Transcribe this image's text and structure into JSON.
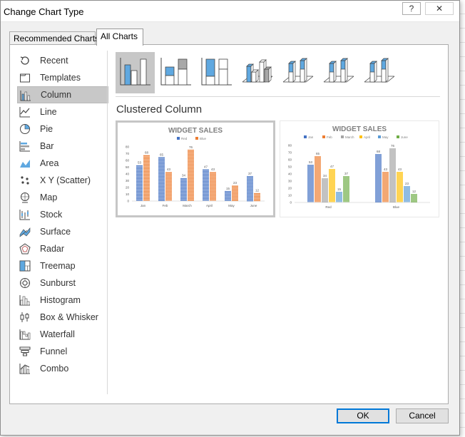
{
  "window": {
    "title": "Change Chart Type",
    "help_label": "?",
    "close_label": "✕"
  },
  "tabs": [
    {
      "label": "Recommended Charts"
    },
    {
      "label": "All Charts"
    }
  ],
  "chart_types": [
    {
      "label": "Recent",
      "icon": "recent-icon"
    },
    {
      "label": "Templates",
      "icon": "templates-icon"
    },
    {
      "label": "Column",
      "icon": "column-icon",
      "selected": true
    },
    {
      "label": "Line",
      "icon": "line-icon"
    },
    {
      "label": "Pie",
      "icon": "pie-icon"
    },
    {
      "label": "Bar",
      "icon": "bar-icon"
    },
    {
      "label": "Area",
      "icon": "area-icon"
    },
    {
      "label": "X Y (Scatter)",
      "icon": "scatter-icon"
    },
    {
      "label": "Map",
      "icon": "map-icon"
    },
    {
      "label": "Stock",
      "icon": "stock-icon"
    },
    {
      "label": "Surface",
      "icon": "surface-icon"
    },
    {
      "label": "Radar",
      "icon": "radar-icon"
    },
    {
      "label": "Treemap",
      "icon": "treemap-icon"
    },
    {
      "label": "Sunburst",
      "icon": "sunburst-icon"
    },
    {
      "label": "Histogram",
      "icon": "histogram-icon"
    },
    {
      "label": "Box & Whisker",
      "icon": "box-whisker-icon"
    },
    {
      "label": "Waterfall",
      "icon": "waterfall-icon"
    },
    {
      "label": "Funnel",
      "icon": "funnel-icon"
    },
    {
      "label": "Combo",
      "icon": "combo-icon"
    }
  ],
  "subtypes": [
    {
      "name": "clustered-column",
      "selected": true
    },
    {
      "name": "stacked-column"
    },
    {
      "name": "100-stacked-column"
    },
    {
      "name": "3d-clustered-column"
    },
    {
      "name": "3d-stacked-column"
    },
    {
      "name": "3d-100-stacked-column"
    },
    {
      "name": "3d-column"
    }
  ],
  "selected_subtype_title": "Clustered Column",
  "colors": {
    "red_series": "#4472c4",
    "blue_series": "#ed7d31",
    "march": "#a5a5a5",
    "april": "#ffc000",
    "may": "#5b9bd5",
    "june": "#70ad47",
    "icon_blue": "#5fa8e0"
  },
  "chart_data": [
    {
      "type": "bar",
      "title": "WIDGET SALES",
      "categories": [
        "Jan",
        "Feb",
        "March",
        "April",
        "May",
        "June"
      ],
      "series": [
        {
          "name": "Red",
          "values": [
            53,
            65,
            34,
            47,
            15,
            37
          ]
        },
        {
          "name": "Blue",
          "values": [
            68,
            43,
            76,
            43,
            23,
            12
          ]
        }
      ],
      "ylim": [
        0,
        80
      ],
      "yticks": [
        0,
        10,
        20,
        30,
        40,
        50,
        60,
        70,
        80
      ],
      "legend": "top"
    },
    {
      "type": "bar",
      "title": "WIDGET SALES",
      "categories": [
        "Red",
        "Blue"
      ],
      "series": [
        {
          "name": "Jan",
          "values": [
            53,
            68
          ]
        },
        {
          "name": "Feb",
          "values": [
            65,
            43
          ]
        },
        {
          "name": "March",
          "values": [
            34,
            76
          ]
        },
        {
          "name": "April",
          "values": [
            47,
            43
          ]
        },
        {
          "name": "May",
          "values": [
            15,
            23
          ]
        },
        {
          "name": "June",
          "values": [
            37,
            12
          ]
        }
      ],
      "ylim": [
        0,
        80
      ],
      "yticks": [
        0,
        10,
        20,
        30,
        40,
        50,
        60,
        70,
        80
      ],
      "legend": "top"
    }
  ],
  "buttons": {
    "ok": "OK",
    "cancel": "Cancel"
  }
}
